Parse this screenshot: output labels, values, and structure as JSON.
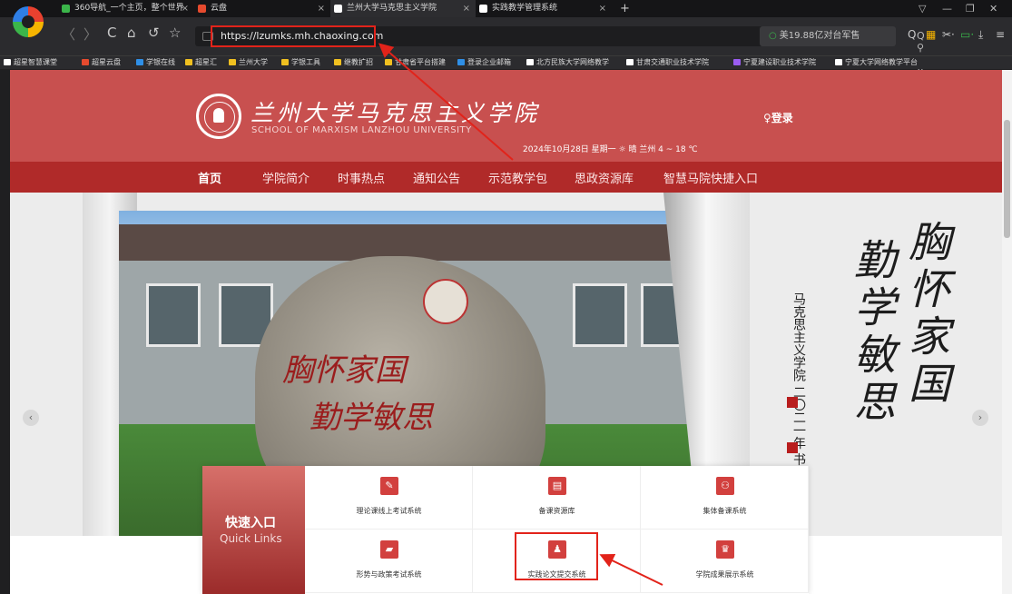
{
  "tabs": [
    {
      "label": "360导航_一个主页，整个世界",
      "active": false
    },
    {
      "label": "云盘",
      "active": false
    },
    {
      "label": "兰州大学马克思主义学院",
      "active": true
    },
    {
      "label": "实践教学管理系统",
      "active": false
    }
  ],
  "tab_close": "×",
  "new_tab": "+",
  "window_controls": {
    "menu": "▽",
    "minimize": "—",
    "maximize": "❐",
    "close": "✕"
  },
  "nav": {
    "back": "〈",
    "forward": "〉",
    "reload": "C",
    "home": "⌂",
    "undo": "↺",
    "star": "☆"
  },
  "address": {
    "url": "https://lzumks.mh.chaoxing.com"
  },
  "url_actions": "Q ⚲ ★ ∨",
  "search": {
    "text": "美19.88亿对台军售"
  },
  "toolbar_icons": [
    "Q",
    "▦",
    "✂·",
    "▭·",
    "⤓",
    "≡"
  ],
  "bookmarks": [
    "超星智慧课堂",
    "超星云盘",
    "学银在线",
    "超星汇",
    "兰州大学",
    "学银工具",
    "继教扩招",
    "甘肃省平台搭建",
    "登录企业邮箱",
    "北方民族大学网络教学",
    "甘肃交通职业技术学院",
    "宁夏建设职业技术学院",
    "宁夏大学网络教学平台"
  ],
  "site": {
    "title_cn": "兰州大学马克思主义学院",
    "title_en": "SCHOOL OF MARXISM LANZHOU UNIVERSITY",
    "date_weather": "2024年10月28日 星期一  ☼ 晴 兰州 4 ~ 18 ℃",
    "login": "♀登录",
    "menu": [
      "首页",
      "学院简介",
      "时事热点",
      "通知公告",
      "示范教学包",
      "思政资源库",
      "智慧马院快捷入口"
    ],
    "stone_line1": "胸怀家国",
    "stone_line2": "勤学敏思",
    "callig_col1": "胸怀家国",
    "callig_col2": "勤学敏思",
    "callig_small": "马克思主义学院 二〇二一年 书",
    "prev": "‹",
    "next": "›"
  },
  "quick_links": {
    "title_cn": "快速入口",
    "title_en": "Quick Links",
    "items": [
      {
        "label": "理论课线上考试系统",
        "icon": "edit-icon",
        "glyph": "✎"
      },
      {
        "label": "备课资源库",
        "icon": "board-icon",
        "glyph": "▤"
      },
      {
        "label": "集体备课系统",
        "icon": "group-icon",
        "glyph": "⚇"
      },
      {
        "label": "形势与政策考试系统",
        "icon": "folder-icon",
        "glyph": "▰"
      },
      {
        "label": "实践论文提交系统",
        "icon": "person-icon",
        "glyph": "♟"
      },
      {
        "label": "学院成果展示系统",
        "icon": "trophy-icon",
        "glyph": "♛"
      }
    ]
  },
  "colors": {
    "brand_red": "#c8504f",
    "menu_red": "#b02a29",
    "highlight": "#e2231a"
  }
}
